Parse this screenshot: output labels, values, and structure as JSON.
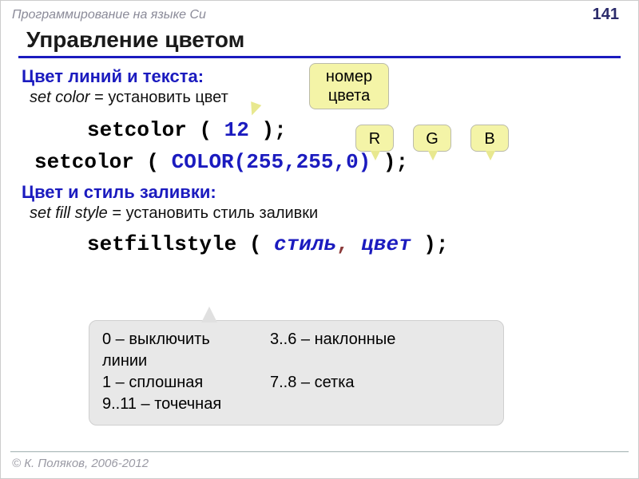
{
  "header": {
    "title": "Программирование на языке Си",
    "page": "141"
  },
  "title": "Управление цветом",
  "section1": {
    "label": "Цвет линий и текста:",
    "ital": "set color",
    "eq": " = установить цвет",
    "code1_a": "setcolor ( ",
    "code1_num": "12",
    "code1_b": " );",
    "code2_a": "setcolor ( ",
    "code2_b": "COLOR(255,255,0)",
    "code2_c": " );"
  },
  "callout_num": {
    "l1": "номер",
    "l2": "цвета"
  },
  "rgb": [
    "R",
    "G",
    "B"
  ],
  "section2": {
    "label": "Цвет и стиль заливки:",
    "ital": "set fill style",
    "eq": " = установить стиль заливки",
    "code_a": "setfillstyle ( ",
    "code_s": "стиль",
    "code_comma": ",",
    "code_sp": " ",
    "code_c": "цвет",
    "code_b": " );"
  },
  "styles_box": {
    "r1c1": "0 – выключить",
    "r1c2": "3..6 – наклонные",
    "r2": "линии",
    "r3c1": "1 – сплошная",
    "r3c2": "7..8 – сетка",
    "r4": " 9..11 – точечная"
  },
  "footer": "© К. Поляков, 2006-2012"
}
